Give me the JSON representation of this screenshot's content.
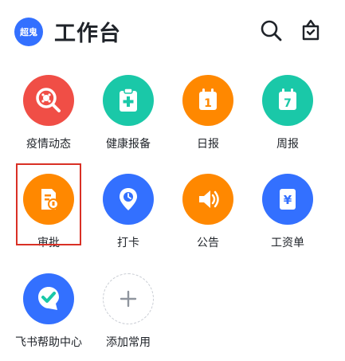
{
  "header": {
    "avatar_text": "超鬼",
    "title": "工作台"
  },
  "colors": {
    "accent": "#3370ff",
    "red": "#f04e46",
    "teal": "#1ac8a8",
    "orange": "#ff8800",
    "blue": "#3370ff",
    "highlight": "#d93025"
  },
  "apps": [
    {
      "label": "疫情动态",
      "icon": "virus-search-icon"
    },
    {
      "label": "健康报备",
      "icon": "medical-clipboard-icon"
    },
    {
      "label": "日报",
      "icon": "daily-calendar-icon",
      "day": "1"
    },
    {
      "label": "周报",
      "icon": "weekly-calendar-icon",
      "day": "7"
    },
    {
      "label": "审批",
      "icon": "approval-document-icon"
    },
    {
      "label": "打卡",
      "icon": "location-pin-icon"
    },
    {
      "label": "公告",
      "icon": "speaker-icon"
    },
    {
      "label": "工资单",
      "icon": "yen-document-icon",
      "symbol": "¥"
    },
    {
      "label": "飞书帮助中心",
      "icon": "help-check-shield-icon"
    },
    {
      "label": "添加常用",
      "icon": "plus-icon"
    }
  ]
}
